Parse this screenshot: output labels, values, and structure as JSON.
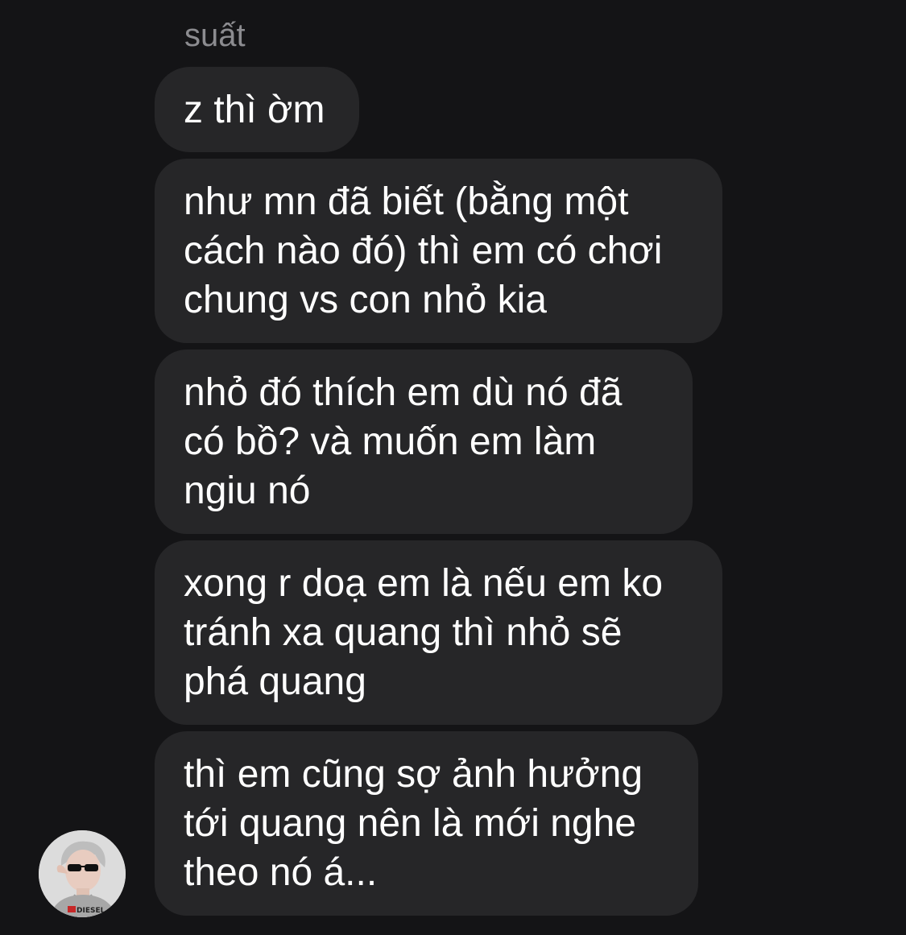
{
  "conversation": {
    "truncated_text": "suất",
    "messages": [
      {
        "text": "z thì ờm"
      },
      {
        "text": "như mn đã biết (bằng một\ncách nào đó) thì em có chơi\nchung vs con nhỏ kia"
      },
      {
        "text": "nhỏ đó thích em dù nó đã\ncó bồ? và muốn em làm\nngiu nó"
      },
      {
        "text": "xong r doạ em là nếu em ko\ntránh xa quang thì nhỏ sẽ\nphá quang"
      },
      {
        "text": "thì em cũng sợ ảnh hưởng\ntới quang nên là mới nghe\ntheo nó á..."
      }
    ],
    "avatar": {
      "icon": "user-avatar-photo",
      "shirt_text": "DIESEL"
    }
  },
  "colors": {
    "background": "#141416",
    "bubble": "#262628",
    "text": "#ffffff",
    "muted_text": "#8c8c90"
  }
}
